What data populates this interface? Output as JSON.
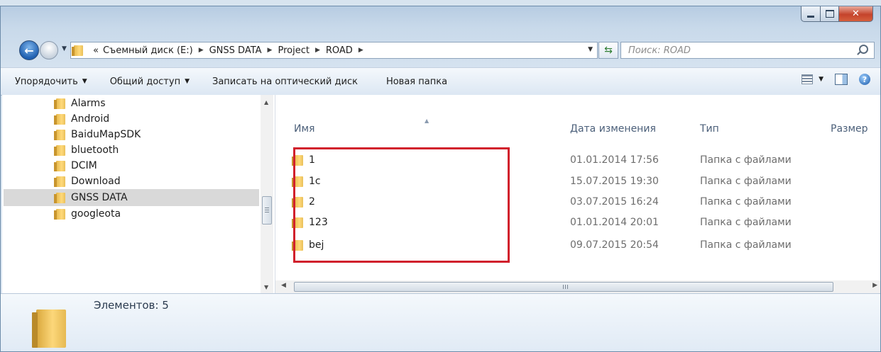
{
  "address": {
    "overflow": "«",
    "crumbs": [
      "Съемный диск (E:)",
      "GNSS DATA",
      "Project",
      "ROAD"
    ]
  },
  "search": {
    "placeholder": "Поиск: ROAD"
  },
  "toolbar": {
    "organize": "Упорядочить",
    "share": "Общий доступ",
    "burn": "Записать на оптический диск",
    "new_folder": "Новая папка"
  },
  "nav_pane": {
    "items": [
      "Alarms",
      "Android",
      "BaiduMapSDK",
      "bluetooth",
      "DCIM",
      "Download",
      "GNSS DATA",
      "googleota"
    ],
    "selected": "GNSS DATA"
  },
  "columns": {
    "name": "Имя",
    "date": "Дата изменения",
    "type": "Тип",
    "size": "Размер"
  },
  "files": [
    {
      "name": "1",
      "date": "01.01.2014 17:56",
      "type": "Папка с файлами"
    },
    {
      "name": "1c",
      "date": "15.07.2015 19:30",
      "type": "Папка с файлами"
    },
    {
      "name": "2",
      "date": "03.07.2015 16:24",
      "type": "Папка с файлами"
    },
    {
      "name": "123",
      "date": "01.01.2014 20:01",
      "type": "Папка с файлами"
    },
    {
      "name": "bej",
      "date": "09.07.2015 20:54",
      "type": "Папка с файлами"
    }
  ],
  "details": {
    "count": "Элементов: 5"
  },
  "colors": {
    "highlight": "#d1202c",
    "selection": "#d9d9d9"
  }
}
